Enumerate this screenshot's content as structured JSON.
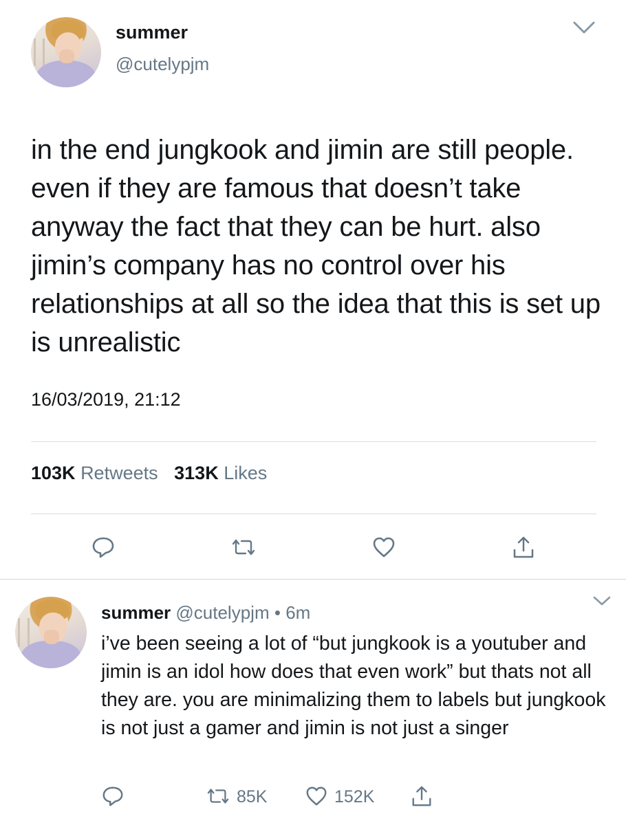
{
  "main_tweet": {
    "display_name": "summer",
    "handle": "@cutelypjm",
    "text": "in the end jungkook and jimin are still people. even if they are famous that doesn’t take anyway the fact that they can be hurt. also jimin’s company has no control over his relationships at all so the idea that this is set up is unrealistic",
    "timestamp": "16/03/2019, 21:12",
    "retweets_count": "103K",
    "retweets_label": "Retweets",
    "likes_count": "313K",
    "likes_label": "Likes",
    "actions": [
      "reply-icon",
      "retweet-icon",
      "like-icon",
      "share-icon"
    ]
  },
  "reply_tweet": {
    "display_name": "summer",
    "handle": "@cutelypjm",
    "separator": "•",
    "time_ago": "6m",
    "text": "i’ve been seeing a lot of “but jungkook is a youtuber and jimin is an idol how does that even work” but thats not all they are. you are minimalizing them to labels but jungkook is not just a gamer and jimin is not just a singer",
    "retweets_count": "85K",
    "likes_count": "152K",
    "actions": [
      "reply-icon",
      "retweet-icon",
      "like-icon",
      "share-icon"
    ]
  },
  "colors": {
    "text": "#14171a",
    "secondary": "#657786",
    "divider": "#d7dde2",
    "background": "#ffffff"
  }
}
